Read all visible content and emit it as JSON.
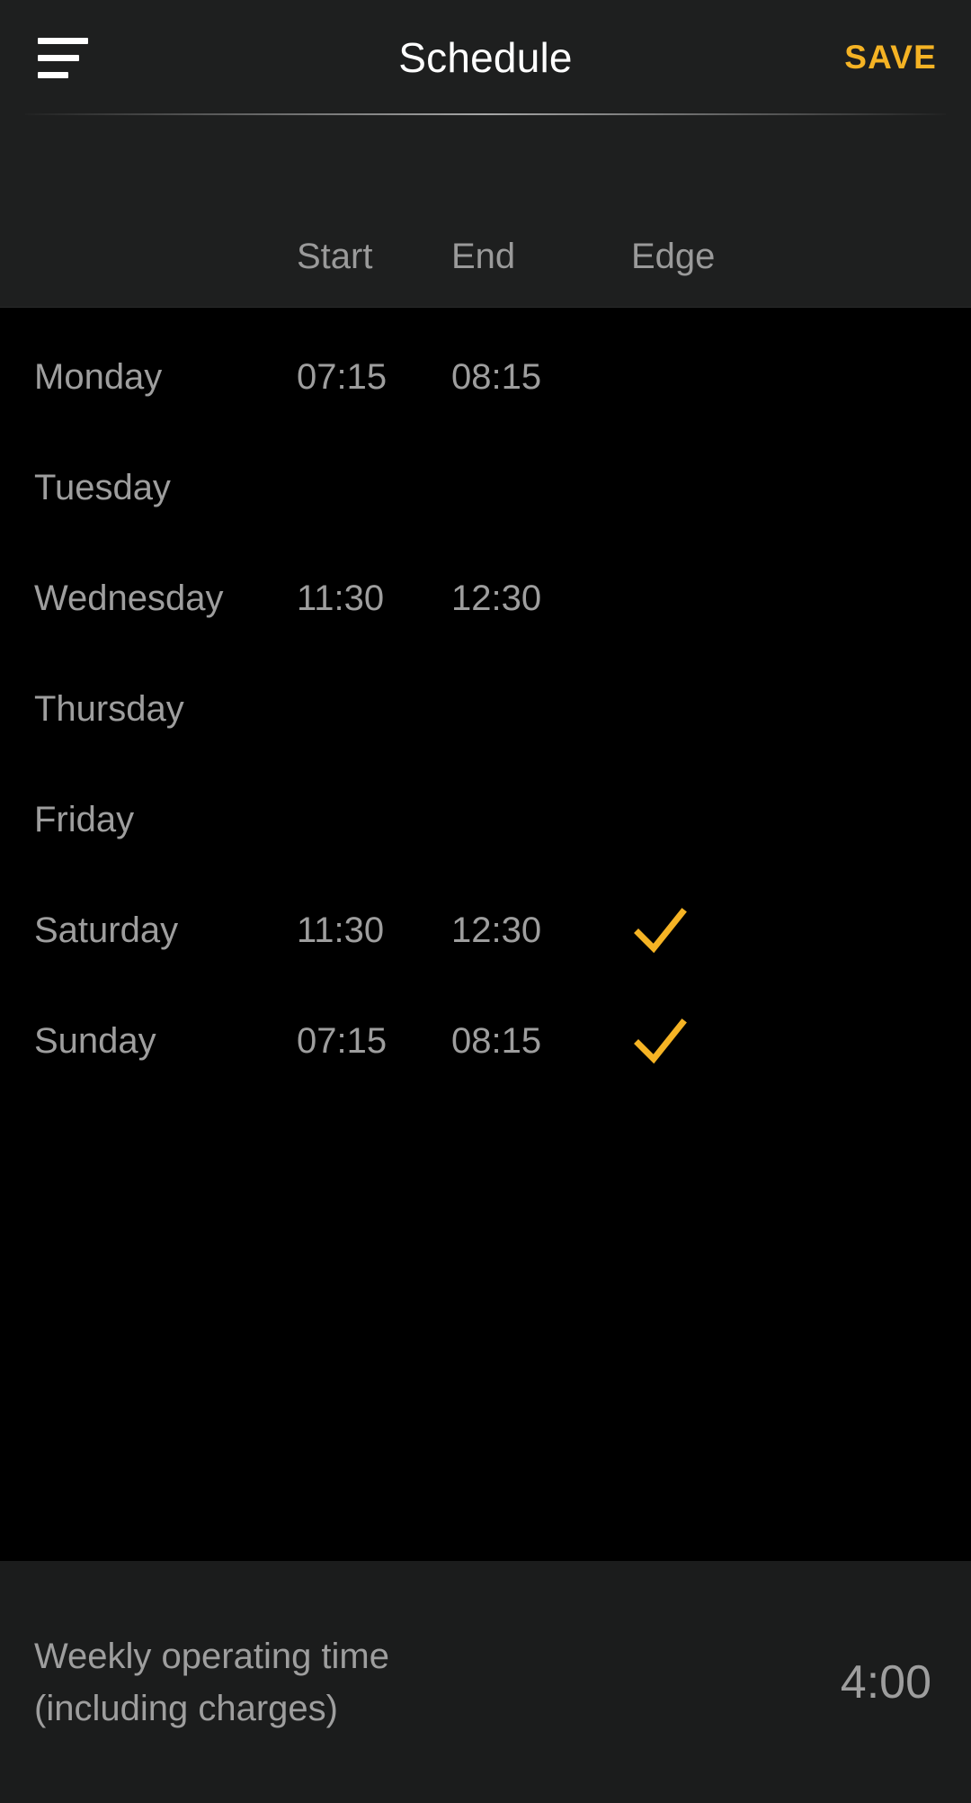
{
  "header": {
    "title": "Schedule",
    "menu_icon": "hamburger-menu-icon",
    "save_label": "SAVE",
    "accent_color": "#f5b324"
  },
  "table": {
    "columns": {
      "day_label": "",
      "start_label": "Start",
      "end_label": "End",
      "edge_label": "Edge"
    },
    "rows": [
      {
        "day": "Monday",
        "start": "07:15",
        "end": "08:15",
        "edge": false
      },
      {
        "day": "Tuesday",
        "start": "",
        "end": "",
        "edge": false
      },
      {
        "day": "Wednesday",
        "start": "11:30",
        "end": "12:30",
        "edge": false
      },
      {
        "day": "Thursday",
        "start": "",
        "end": "",
        "edge": false
      },
      {
        "day": "Friday",
        "start": "",
        "end": "",
        "edge": false
      },
      {
        "day": "Saturday",
        "start": "11:30",
        "end": "12:30",
        "edge": true
      },
      {
        "day": "Sunday",
        "start": "07:15",
        "end": "08:15",
        "edge": true
      }
    ]
  },
  "footer": {
    "label_line1": "Weekly operating time",
    "label_line2": "(including charges)",
    "value": "4:00"
  }
}
